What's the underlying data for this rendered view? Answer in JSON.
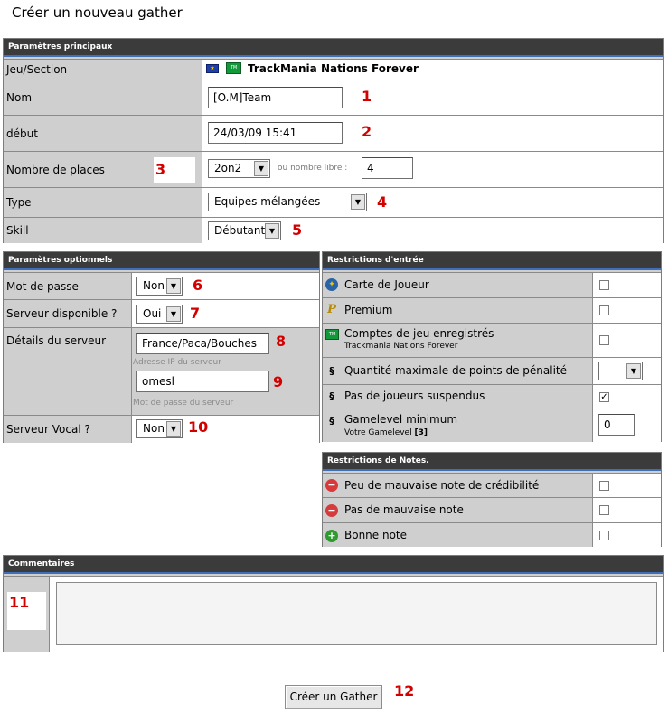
{
  "page_title": "Créer un nouveau gather",
  "main": {
    "header": "Paramètres principaux",
    "game_label": "Jeu/Section",
    "game_value": "TrackMania Nations Forever",
    "name_label": "Nom",
    "name_value": "[O.M]Team",
    "name_num": "1",
    "start_label": "début",
    "start_value": "24/03/09 15:41",
    "start_num": "2",
    "places_label": "Nombre de places",
    "places_num": "3",
    "places_select": "2on2",
    "places_free_label": "ou nombre libre :",
    "places_free_value": "4",
    "type_label": "Type",
    "type_value": "Equipes mélangées",
    "type_num": "4",
    "skill_label": "Skill",
    "skill_value": "Débutant",
    "skill_num": "5"
  },
  "optional": {
    "header": "Paramètres optionnels",
    "password_label": "Mot de passe",
    "password_value": "Non",
    "password_num": "6",
    "server_label": "Serveur disponible ?",
    "server_value": "Oui",
    "server_num": "7",
    "details_label": "Détails du serveur",
    "details_ip_value": "France/Paca/Bouches",
    "details_ip_num": "8",
    "details_ip_hint": "Adresse IP du serveur",
    "details_pw_value": "omesl",
    "details_pw_num": "9",
    "details_pw_hint": "Mot de passe du serveur",
    "voice_label": "Serveur Vocal ?",
    "voice_value": "Non",
    "voice_num": "10"
  },
  "entry": {
    "header": "Restrictions d'entrée",
    "items": [
      {
        "label": "Carte de Joueur",
        "icon": "player-card-icon"
      },
      {
        "label": "Premium",
        "icon": "premium-icon"
      },
      {
        "label": "Comptes de jeu enregistrés",
        "sub": "Trackmania Nations Forever",
        "icon": "game-account-icon"
      },
      {
        "label": "Quantité maximale de points de pénalité",
        "icon": "section-icon"
      },
      {
        "label": "Pas de joueurs suspendus",
        "icon": "section-icon",
        "checked": "✓"
      },
      {
        "label": "Gamelevel minimum",
        "sub_prefix": "Votre Gamelevel",
        "sub_value": "[3]",
        "icon": "section-icon",
        "value": "0"
      }
    ]
  },
  "notes": {
    "header": "Restrictions de Notes.",
    "items": [
      {
        "label": "Peu de mauvaise note de crédibilité"
      },
      {
        "label": "Pas de mauvaise note"
      },
      {
        "label": "Bonne note"
      }
    ]
  },
  "comments": {
    "header": "Commentaires",
    "num": "11"
  },
  "submit": {
    "label": "Créer un Gather",
    "num": "12"
  },
  "colors": {
    "panel_header": "#3b3b3b",
    "header_accent": "#3f6fb8",
    "annotation": "#d30000",
    "label_bg": "#cfcfcf"
  }
}
